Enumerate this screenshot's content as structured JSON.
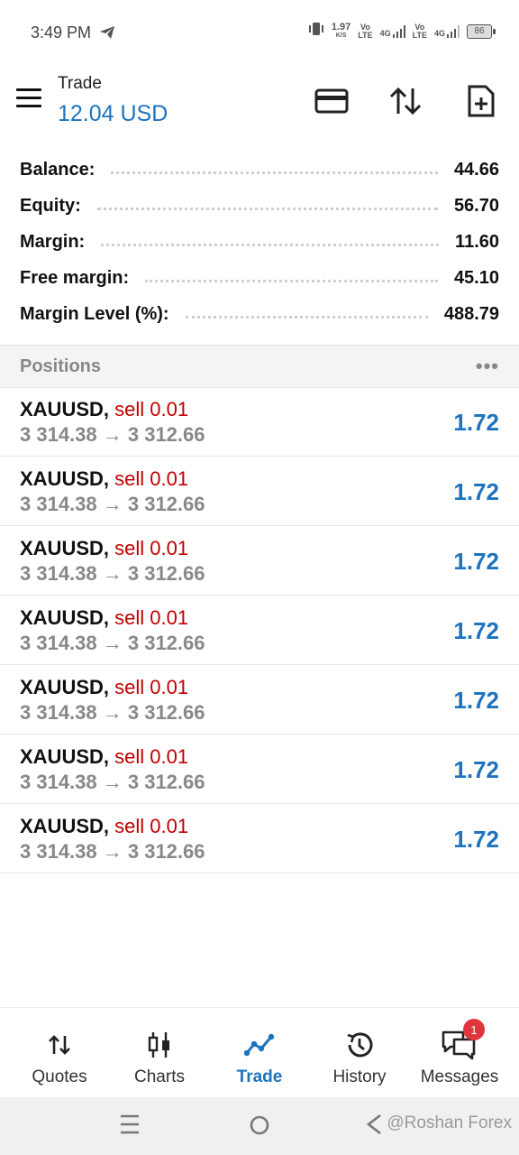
{
  "status_bar": {
    "time": "3:49 PM",
    "net_speed_value": "1.97",
    "net_speed_unit": "K/S",
    "sim1_top": "Vo",
    "sim1_bottom": "LTE",
    "sim1_net": "4G",
    "sim2_top": "Vo",
    "sim2_bottom": "LTE",
    "sim2_net": "4G",
    "battery": "86"
  },
  "header": {
    "title": "Trade",
    "subtitle": "12.04 USD"
  },
  "summary": [
    {
      "label": "Balance:",
      "value": "44.66"
    },
    {
      "label": "Equity:",
      "value": "56.70"
    },
    {
      "label": "Margin:",
      "value": "11.60"
    },
    {
      "label": "Free margin:",
      "value": "45.10"
    },
    {
      "label": "Margin Level (%):",
      "value": "488.79"
    }
  ],
  "positions": {
    "title": "Positions",
    "more": "•••",
    "items": [
      {
        "symbol": "XAUUSD,",
        "side": "sell 0.01",
        "prices": "3 314.38 → 3 312.66",
        "profit": "1.72"
      },
      {
        "symbol": "XAUUSD,",
        "side": "sell 0.01",
        "prices": "3 314.38 → 3 312.66",
        "profit": "1.72"
      },
      {
        "symbol": "XAUUSD,",
        "side": "sell 0.01",
        "prices": "3 314.38 → 3 312.66",
        "profit": "1.72"
      },
      {
        "symbol": "XAUUSD,",
        "side": "sell 0.01",
        "prices": "3 314.38 → 3 312.66",
        "profit": "1.72"
      },
      {
        "symbol": "XAUUSD,",
        "side": "sell 0.01",
        "prices": "3 314.38 → 3 312.66",
        "profit": "1.72"
      },
      {
        "symbol": "XAUUSD,",
        "side": "sell 0.01",
        "prices": "3 314.38 → 3 312.66",
        "profit": "1.72"
      },
      {
        "symbol": "XAUUSD,",
        "side": "sell 0.01",
        "prices": "3 314.38 → 3 312.66",
        "profit": "1.72"
      }
    ]
  },
  "bottom_nav": {
    "quotes": "Quotes",
    "charts": "Charts",
    "trade": "Trade",
    "history": "History",
    "messages": "Messages",
    "messages_badge": "1"
  },
  "watermark": "@Roshan Forex",
  "colors": {
    "accent": "#1e73be",
    "sell": "#c00000",
    "badge": "#e0353b"
  }
}
